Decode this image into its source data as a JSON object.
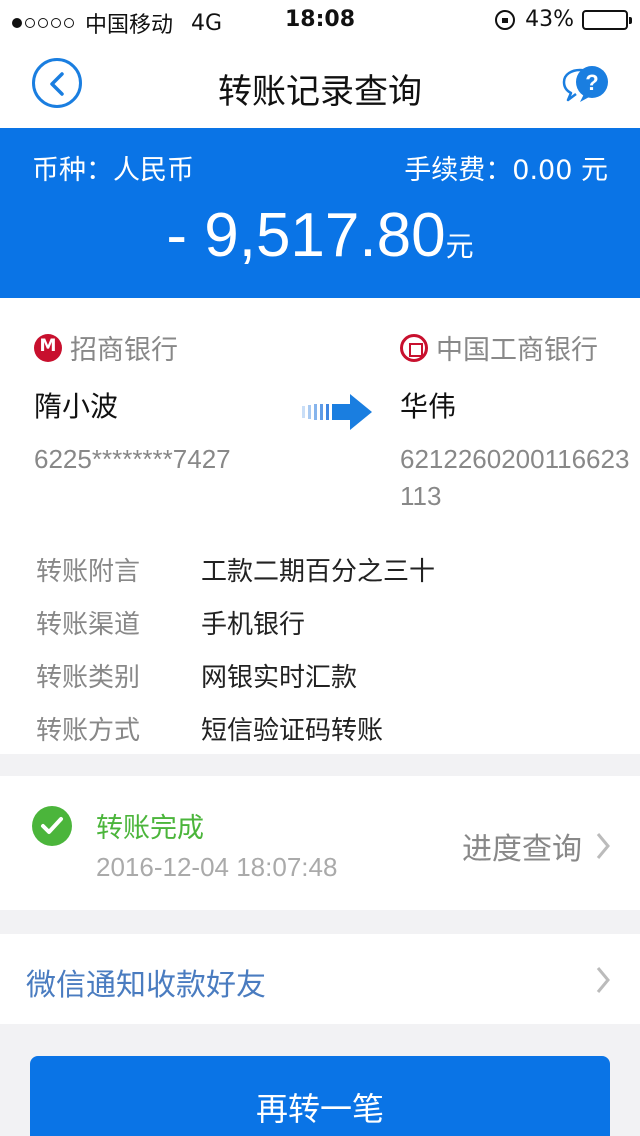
{
  "status_bar": {
    "carrier": "中国移动",
    "network": "4G",
    "time": "18:08",
    "battery": "43%",
    "battery_level": 0.43,
    "signal_bars_filled": 1
  },
  "nav": {
    "title": "转账记录查询",
    "back_icon": "chevron-left-icon",
    "help_icon": "help-chat-icon"
  },
  "summary": {
    "currency_label": "币种：人民币",
    "fee_label": "手续费：0.00 元",
    "amount": "- 9,517.80",
    "amount_unit": "元"
  },
  "transfer": {
    "from": {
      "bank": "招商银行",
      "name": "隋小波",
      "account": "6225********7427"
    },
    "to": {
      "bank": "中国工商银行",
      "name": "华伟",
      "account": "6212260200116623113"
    }
  },
  "details": [
    {
      "key": "转账附言",
      "value": "工款二期百分之三十"
    },
    {
      "key": "转账渠道",
      "value": "手机银行"
    },
    {
      "key": "转账类别",
      "value": "网银实时汇款"
    },
    {
      "key": "转账方式",
      "value": "短信验证码转账"
    }
  ],
  "status": {
    "text": "转账完成",
    "time": "2016-12-04 18:07:48",
    "progress_link": "进度查询"
  },
  "notify": {
    "label": "微信通知收款好友"
  },
  "actions": {
    "again_label": "再转一笔"
  },
  "colors": {
    "primary": "#0a74e6",
    "success": "#4bb53b",
    "bank_red": "#c8102e"
  }
}
